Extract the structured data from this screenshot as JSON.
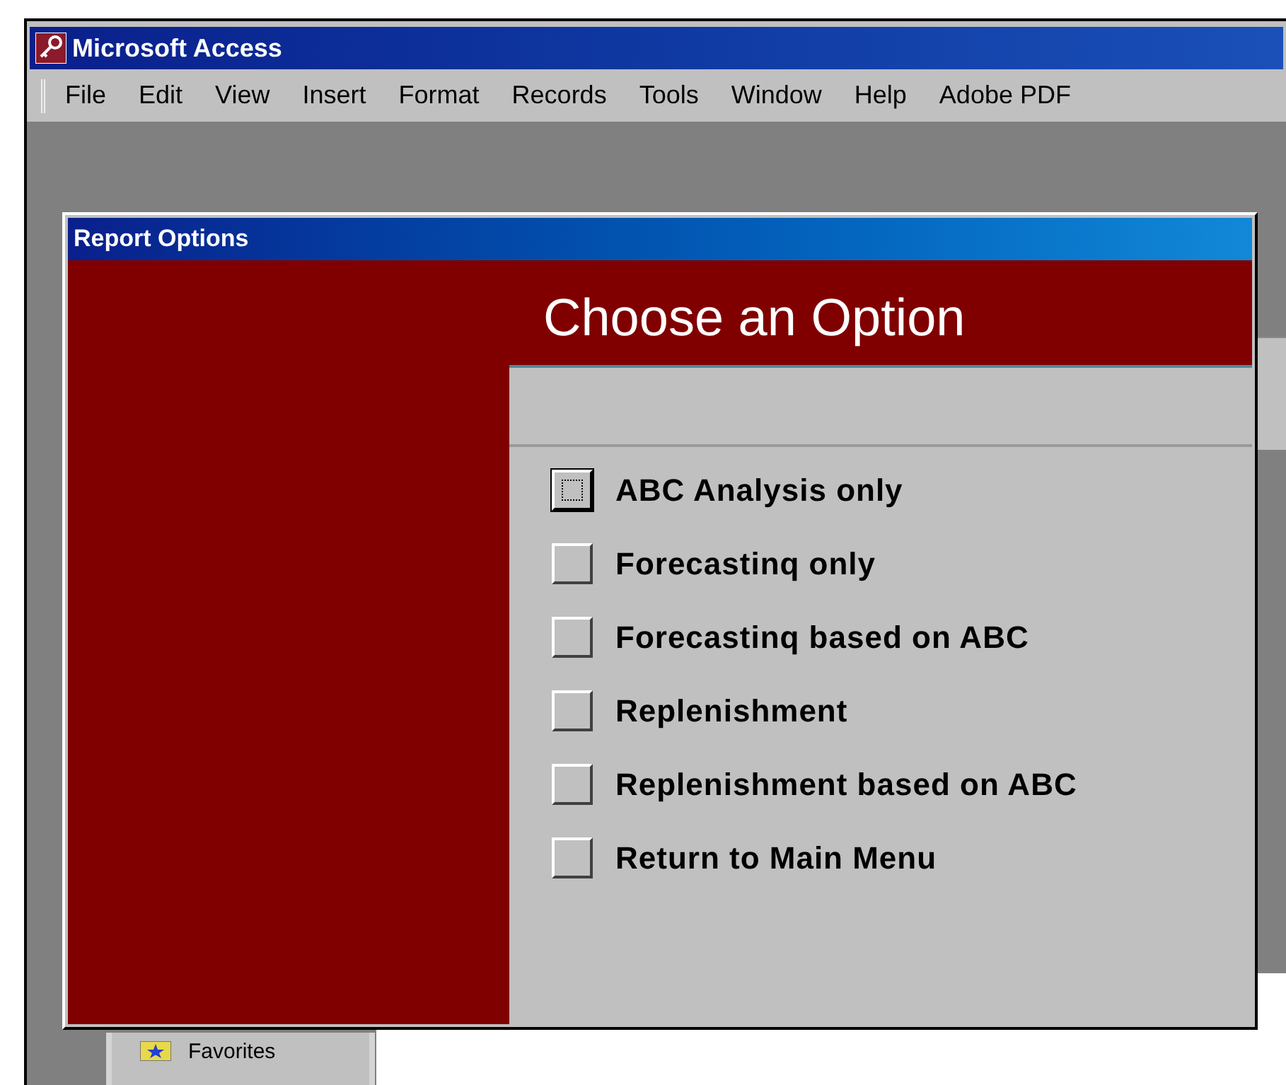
{
  "window": {
    "title": "Microsoft Access"
  },
  "menu": [
    {
      "label": "File"
    },
    {
      "label": "Edit"
    },
    {
      "label": "View"
    },
    {
      "label": "Insert"
    },
    {
      "label": "Format"
    },
    {
      "label": "Records"
    },
    {
      "label": "Tools"
    },
    {
      "label": "Window"
    },
    {
      "label": "Help"
    },
    {
      "label": "Adobe PDF"
    }
  ],
  "dialog": {
    "title": "Report Options",
    "heading": "Choose an Option",
    "options": [
      {
        "label": "ABC Analysis only",
        "focused": true
      },
      {
        "label": "Forecastinq only",
        "focused": false
      },
      {
        "label": "Forecastinq based on ABC",
        "focused": false
      },
      {
        "label": "Replenishment",
        "focused": false
      },
      {
        "label": "Replenishment based on ABC",
        "focused": false
      },
      {
        "label": "Return to Main Menu",
        "focused": false
      }
    ]
  },
  "database_window": {
    "item": "Favorites"
  }
}
